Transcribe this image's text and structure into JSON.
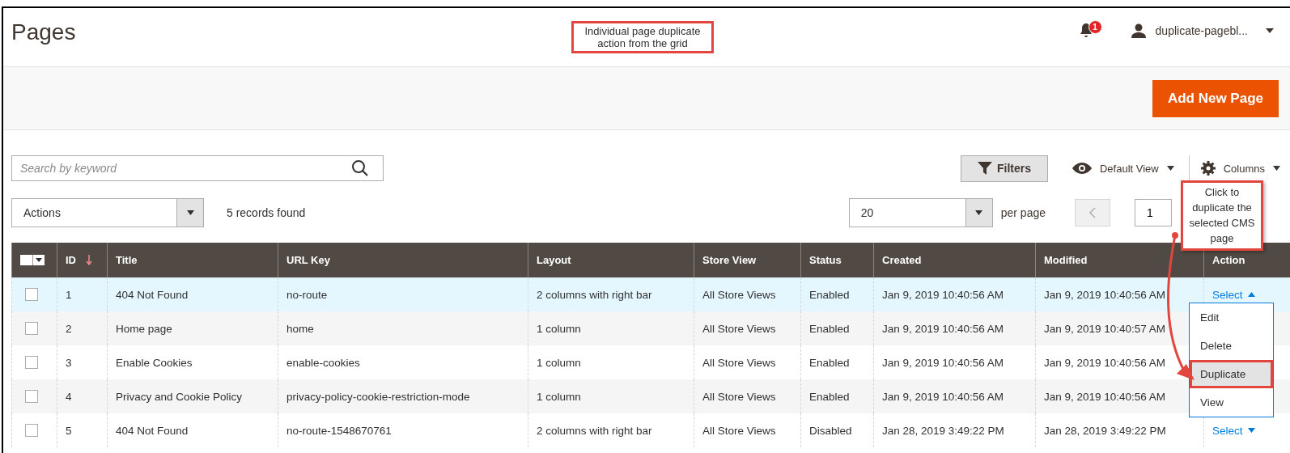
{
  "header": {
    "title": "Pages",
    "notification_count": "1",
    "user": "duplicate-pagebl..."
  },
  "annotations": [
    {
      "text": "Individual page duplicate action from the grid"
    },
    {
      "text": "Click to duplicate the selected CMS page"
    }
  ],
  "add_button": "Add New Page",
  "toolbar": {
    "search": {
      "placeholder": "Search by keyword"
    },
    "filters": "Filters",
    "view": "Default View",
    "columns": "Columns"
  },
  "mass_actions": "Actions",
  "records": "5 records found",
  "per_page": {
    "value": "20",
    "label": "per page"
  },
  "page": "1",
  "table": {
    "select_all": {
      "checked": false
    },
    "columns": [
      "ID",
      "Title",
      "URL Key",
      "Layout",
      "Store View",
      "Status",
      "Created",
      "Modified",
      "Action"
    ],
    "rows": [
      {
        "selected": true,
        "checked": false,
        "cells": [
          "1",
          "404 Not Found",
          "no-route",
          "2 columns with right bar",
          "All Store Views",
          "Enabled",
          "Jan 9, 2019 10:40:56 AM",
          "Jan 9, 2019 10:40:56 AM"
        ],
        "action": {
          "label": "Select",
          "expanded": true
        }
      },
      {
        "selected": false,
        "checked": false,
        "cells": [
          "2",
          "Home page",
          "home",
          "1 column",
          "All Store Views",
          "Enabled",
          "Jan 9, 2019 10:40:56 AM",
          "Jan 9, 2019 10:40:57 AM"
        ]
      },
      {
        "selected": false,
        "checked": false,
        "cells": [
          "3",
          "Enable Cookies",
          "enable-cookies",
          "1 column",
          "All Store Views",
          "Enabled",
          "Jan 9, 2019 10:40:56 AM",
          "Jan 9, 2019 10:40:56 AM"
        ]
      },
      {
        "selected": false,
        "checked": false,
        "cells": [
          "4",
          "Privacy and Cookie Policy",
          "privacy-policy-cookie-restriction-mode",
          "1 column",
          "All Store Views",
          "Enabled",
          "Jan 9, 2019 10:40:56 AM",
          "Jan 9, 2019 10:40:56 AM"
        ]
      },
      {
        "selected": false,
        "checked": false,
        "cells": [
          "5",
          "404 Not Found",
          "no-route-1548670761",
          "2 columns with right bar",
          "All Store Views",
          "Disabled",
          "Jan 28, 2019 3:49:22 PM",
          "Jan 28, 2019 3:49:22 PM"
        ],
        "action": {
          "label": "Select",
          "expanded": false
        }
      }
    ]
  },
  "action_menu": [
    {
      "label": "Edit",
      "selected": false
    },
    {
      "label": "Delete",
      "selected": false
    },
    {
      "label": "Duplicate",
      "selected": true
    },
    {
      "label": "View",
      "selected": false
    }
  ]
}
